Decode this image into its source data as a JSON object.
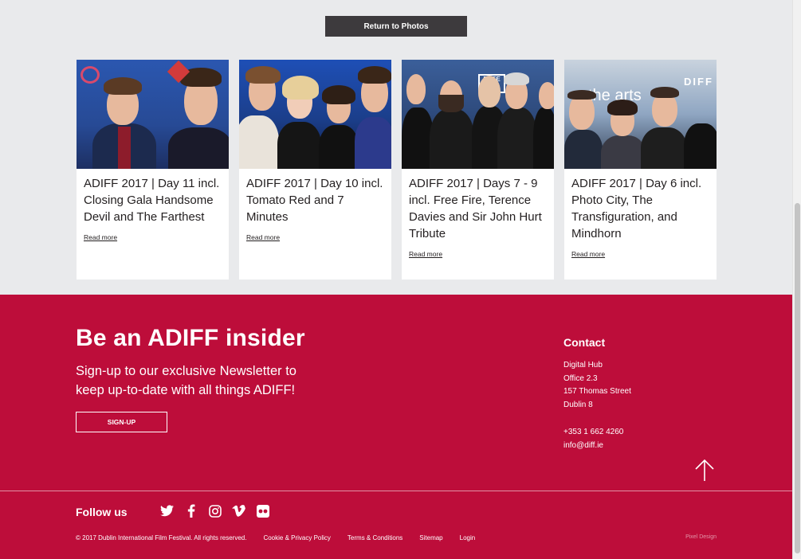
{
  "return_button": "Return to Photos",
  "cards": [
    {
      "title": "ADIFF 2017 | Day 11 incl. Closing Gala Handsome Devil and The Farthest",
      "link": "Read more"
    },
    {
      "title": "ADIFF 2017 | Day 10 incl. Tomato Red and 7 Minutes",
      "link": "Read more"
    },
    {
      "title": "ADIFF 2017 | Days 7 - 9 incl. Free Fire, Terence Davies and Sir John Hurt Tribute",
      "link": "Read more"
    },
    {
      "title": "ADIFF 2017 | Day 6 incl. Photo City, The Transfiguration, and Mindhorn",
      "link": "Read more"
    }
  ],
  "newsletter": {
    "heading": "Be an ADIFF insider",
    "subtext": "Sign-up to our exclusive Newsletter to keep up-to-date with all things ADIFF!",
    "button": "SIGN-UP"
  },
  "contact": {
    "heading": "Contact",
    "address": [
      "Digital Hub",
      "Office 2.3",
      "157 Thomas Street",
      "Dublin 8"
    ],
    "phone": "+353 1 662 4260",
    "email": "info@diff.ie"
  },
  "follow": {
    "label": "Follow us",
    "icons": [
      "twitter-icon",
      "facebook-icon",
      "instagram-icon",
      "vimeo-icon",
      "flickr-icon"
    ]
  },
  "legal": {
    "copyright": "© 2017 Dublin International Film Festival. All rights reserved.",
    "links": [
      "Cookie & Privacy Policy",
      "Terms & Conditions",
      "Sitemap",
      "Login"
    ],
    "credit": "Pixel Design"
  },
  "colors": {
    "footer_bg": "#bd0d3a",
    "page_bg": "#e9eaec",
    "button_dark": "#3d3a3d"
  }
}
